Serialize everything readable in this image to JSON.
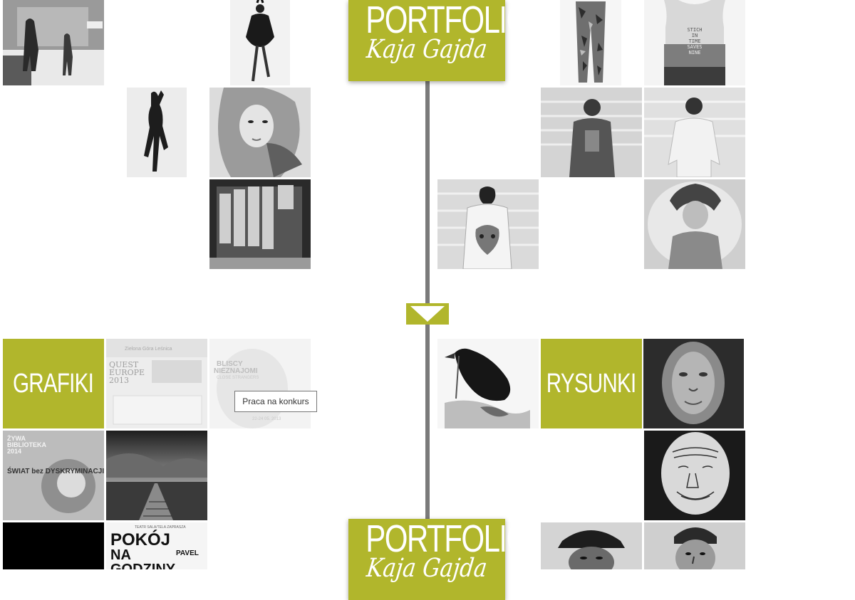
{
  "header": {
    "title": "PORTFOLIO",
    "subtitle": "Kaja Gajda"
  },
  "footer_logo": {
    "title": "PORTFOLIO",
    "subtitle": "Kaja Gajda"
  },
  "sections": {
    "grafiki_label": "GRAFIKI",
    "rysunki_label": "RYSUNKI"
  },
  "tooltip": {
    "text": "Praca na konkurs"
  },
  "posters": {
    "quest_europe": {
      "header": "Zielona Góra Leśnica",
      "title_line1": "QUEST",
      "title_line2": "EUROPE",
      "title_line3": "2013"
    },
    "bliscy": {
      "line1": "BLISCY",
      "line2": "NIEZNAJOMI",
      "line3": "CLOSE STRANGERS",
      "date": "22-24 05. 2013"
    },
    "zywa_biblioteka": {
      "line1": "ŻYWA",
      "line2": "BIBLIOTEKA",
      "line3": "2014",
      "line4": "ŚWIAT bez DYSKRYMINACJI"
    },
    "pokoj": {
      "header": "TEATR SALA/TELA ZAPRASZA",
      "line1": "POKÓJ",
      "line2": "NA",
      "line3": "PAVEL",
      "line4": "GODZINY"
    },
    "tshirt_print": {
      "line1": "STICH",
      "line2": "IN",
      "line3": "TIME",
      "line4": "SAVES",
      "line5": "NINE"
    }
  },
  "colors": {
    "accent": "#b1b62c",
    "timeline": "#7a7a7a",
    "background": "#ffffff"
  },
  "icons": {
    "scroll_down": "triangle-down-icon"
  }
}
